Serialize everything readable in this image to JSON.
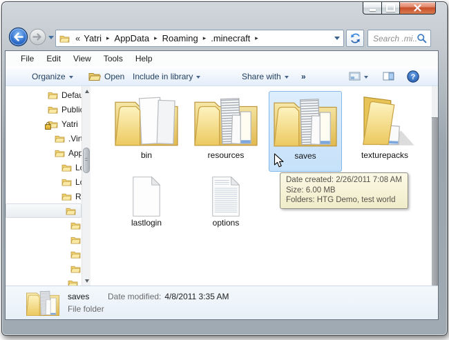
{
  "window": {
    "caption_buttons": [
      {
        "name": "minimize"
      },
      {
        "name": "maximize"
      },
      {
        "name": "close"
      }
    ]
  },
  "navbar": {
    "breadcrumb": {
      "overflow": "«",
      "separator": "▸",
      "segments": [
        "Yatri",
        "AppData",
        "Roaming",
        ".minecraft"
      ]
    },
    "search_placeholder": "Search .mi..."
  },
  "menubar": {
    "items": [
      "File",
      "Edit",
      "View",
      "Tools",
      "Help"
    ]
  },
  "toolbar": {
    "organize_label": "Organize",
    "open_label": "Open",
    "include_label": "Include in library",
    "share_label": "Share with",
    "overflow_label": "»"
  },
  "sidebar": {
    "items": [
      {
        "label": "Defau",
        "indent": 61
      },
      {
        "label": "Public",
        "indent": 61
      },
      {
        "label": "Yatri",
        "indent": 61,
        "locked": true
      },
      {
        "label": ".Virt",
        "indent": 71
      },
      {
        "label": "App",
        "indent": 71
      },
      {
        "label": "Lc",
        "indent": 81
      },
      {
        "label": "Lc",
        "indent": 81
      },
      {
        "label": "Rc",
        "indent": 81
      },
      {
        "label": "",
        "indent": 86,
        "selected": true
      },
      {
        "label": "",
        "indent": 94
      },
      {
        "label": "",
        "indent": 94
      },
      {
        "label": "",
        "indent": 94
      },
      {
        "label": "",
        "indent": 94
      },
      {
        "label": "",
        "indent": 90
      }
    ]
  },
  "files": {
    "items": [
      {
        "label": "bin"
      },
      {
        "label": "resources"
      },
      {
        "label": "saves",
        "selected": true
      },
      {
        "label": "texturepacks"
      },
      {
        "label": "lastlogin"
      },
      {
        "label": "options"
      }
    ]
  },
  "tooltip": {
    "line1": "Date created: 2/26/2011 7:08 AM",
    "line2": "Size: 6.00 MB",
    "line3": "Folders: HTG Demo, test world"
  },
  "details": {
    "name": "saves",
    "date_label": "Date modified:",
    "date_value": "4/8/2011 3:35 AM",
    "type": "File folder"
  },
  "colors": {
    "selection_bg": "#cde4fa",
    "selection_border": "#84b6e8",
    "tooltip_bg": "#f6f2d6",
    "toolbar_text": "#1e3c5c",
    "close_button": "#c74e28"
  }
}
